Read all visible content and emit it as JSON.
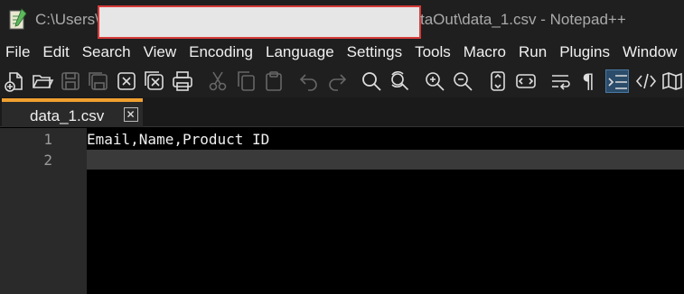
{
  "window": {
    "title_left": "C:\\Users\\",
    "title_right": "taOut\\data_1.csv - Notepad++"
  },
  "menu": [
    "File",
    "Edit",
    "Search",
    "View",
    "Encoding",
    "Language",
    "Settings",
    "Tools",
    "Macro",
    "Run",
    "Plugins",
    "Window"
  ],
  "toolbar_icons": [
    "new-file-icon",
    "open-icon",
    "save-icon",
    "save-all-icon",
    "close-icon",
    "close-all-icon",
    "print-icon",
    "cut-icon",
    "copy-icon",
    "paste-icon",
    "undo-icon",
    "redo-icon",
    "find-icon",
    "replace-icon",
    "zoom-in-icon",
    "zoom-out-icon",
    "sync-vertical-icon",
    "sync-horizontal-icon",
    "word-wrap-icon",
    "show-all-characters-icon",
    "indent-guide-icon",
    "xml-tag-icon",
    "map-icon"
  ],
  "tab": {
    "label": "data_1.csv"
  },
  "editor": {
    "lines": [
      {
        "number": "1",
        "text": "Email,Name,Product ID"
      },
      {
        "number": "2",
        "text": ""
      }
    ]
  },
  "colors": {
    "tab_accent": "#f0a030",
    "redaction_border": "#d63a3a",
    "active_button": "#2b4c6a"
  }
}
